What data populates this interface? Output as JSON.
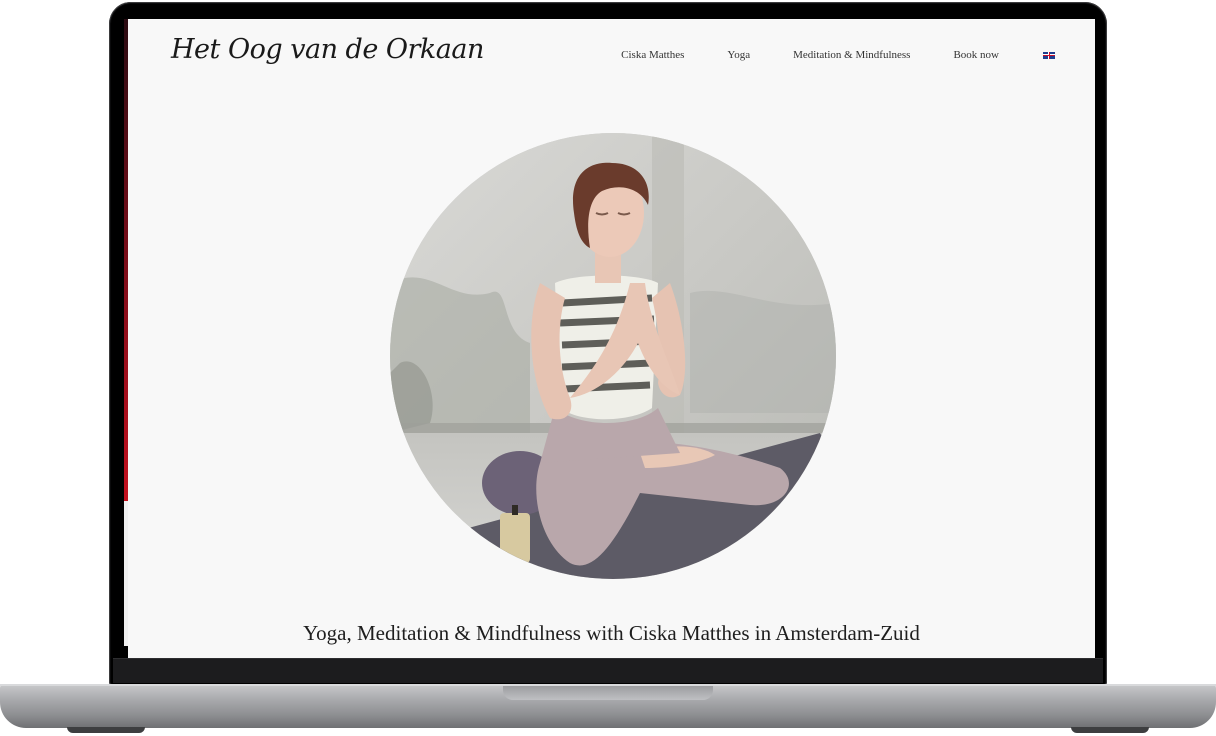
{
  "site": {
    "logo_text": "Het Oog van de Orkaan"
  },
  "nav": {
    "items": [
      {
        "label": "Ciska Matthes"
      },
      {
        "label": "Yoga"
      },
      {
        "label": "Meditation & Mindfulness"
      },
      {
        "label": "Book now"
      }
    ],
    "language_icon": "uk-flag-icon"
  },
  "hero": {
    "image": "meditating-woman-photo"
  },
  "main": {
    "tagline": "Yoga, Meditation & Mindfulness with Ciska Matthes in Amsterdam-Zuid"
  },
  "colors": {
    "page_background": "#f8f8f8",
    "text": "#1e1e1e",
    "laptop_bezel": "#0b0b0c",
    "laptop_body": "#a9aaad"
  }
}
